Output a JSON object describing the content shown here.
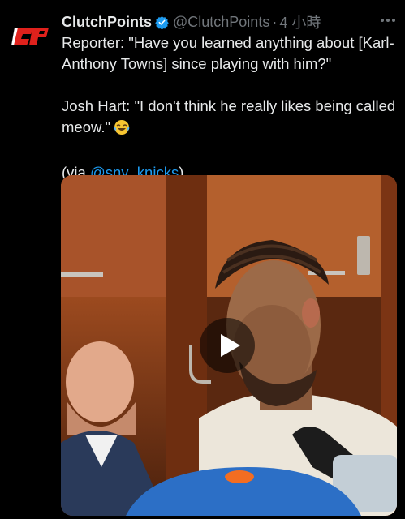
{
  "tweet": {
    "author_name": "ClutchPoints",
    "handle": "@ClutchPoints",
    "separator": "·",
    "time": "4 小時",
    "avatar_text": "CP",
    "line1": "Reporter: \"Have you learned anything about [Karl-Anthony Towns] since playing with him?\"",
    "line2": "Josh Hart: \"I don't think he really likes being called meow.\"",
    "via_prefix": "(via ",
    "via_link": "@sny_knicks",
    "via_suffix": ")"
  },
  "icons": {
    "verified": "verified-badge-icon",
    "more": "more-options-icon",
    "emoji": "tears-of-joy-emoji-icon",
    "play": "play-icon"
  },
  "colors": {
    "background": "#000000",
    "text": "#e7e9ea",
    "secondary": "#71767b",
    "link": "#1d9bf0",
    "verified": "#1d9bf0",
    "brand_red": "#e0211c"
  }
}
